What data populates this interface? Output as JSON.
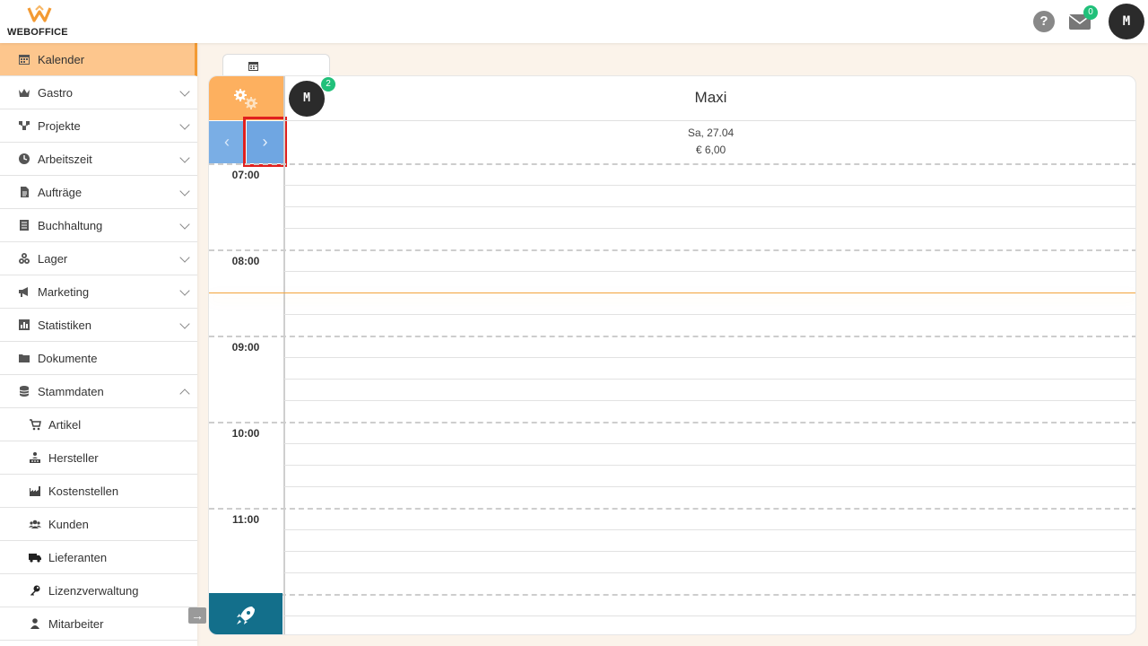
{
  "header": {
    "logo_text": "WEBOFFICE",
    "help_label": "?",
    "mail_count": "0",
    "user_initial": "M"
  },
  "sidebar": {
    "items": [
      {
        "label": "Kalender",
        "icon": "calendar-icon",
        "active": true
      },
      {
        "label": "Gastro",
        "icon": "crown-icon",
        "expandable": true
      },
      {
        "label": "Projekte",
        "icon": "network-icon",
        "expandable": true
      },
      {
        "label": "Arbeitszeit",
        "icon": "clock-icon",
        "expandable": true
      },
      {
        "label": "Aufträge",
        "icon": "document-icon",
        "expandable": true
      },
      {
        "label": "Buchhaltung",
        "icon": "ledger-icon",
        "expandable": true
      },
      {
        "label": "Lager",
        "icon": "boxes-icon",
        "expandable": true
      },
      {
        "label": "Marketing",
        "icon": "megaphone-icon",
        "expandable": true
      },
      {
        "label": "Statistiken",
        "icon": "chart-icon",
        "expandable": true
      },
      {
        "label": "Dokumente",
        "icon": "folder-icon"
      },
      {
        "label": "Stammdaten",
        "icon": "database-icon",
        "expanded": true
      }
    ],
    "sub_items": [
      {
        "label": "Artikel",
        "icon": "cart-icon"
      },
      {
        "label": "Hersteller",
        "icon": "factory-workers-icon"
      },
      {
        "label": "Kostenstellen",
        "icon": "industry-icon"
      },
      {
        "label": "Kunden",
        "icon": "users-icon"
      },
      {
        "label": "Lieferanten",
        "icon": "truck-icon"
      },
      {
        "label": "Lizenzverwaltung",
        "icon": "key-icon"
      },
      {
        "label": "Mitarbeiter",
        "icon": "user-icon"
      }
    ],
    "collapse_glyph": "→"
  },
  "calendar": {
    "employee": {
      "name": "Maxi",
      "initial": "M",
      "badge": "2"
    },
    "day": {
      "label": "Sa, 27.04",
      "amount": "€ 6,00"
    },
    "nav": {
      "prev": "‹",
      "next": "›"
    },
    "times": [
      "07:00",
      "08:00",
      "09:00",
      "10:00",
      "11:00"
    ],
    "colors": {
      "accent": "#fdb05f",
      "nav": "#6fa6e2",
      "now_line": "#f2a43c",
      "rocket": "#136f8b"
    }
  }
}
